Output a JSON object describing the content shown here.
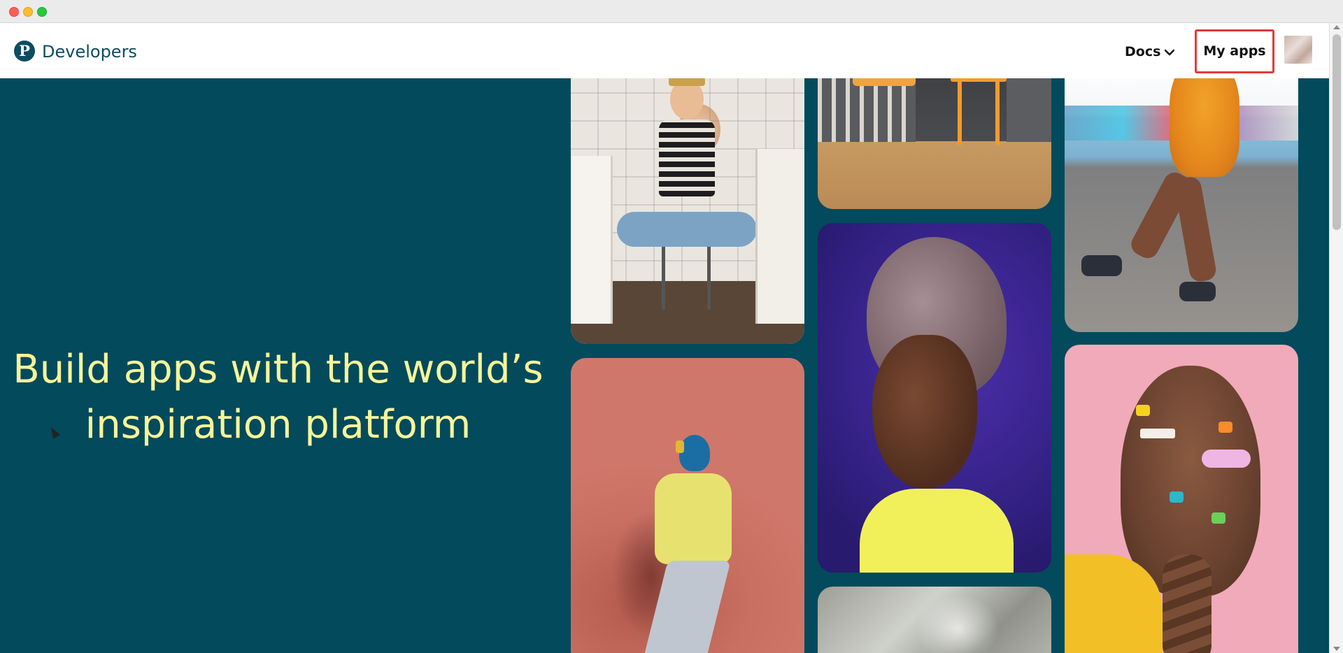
{
  "header": {
    "brand": "Developers",
    "docs_label": "Docs",
    "my_apps_label": "My apps"
  },
  "hero": {
    "line1": "Build apps with the world’s",
    "line2": "inspiration platform"
  },
  "colors": {
    "hero_bg": "#024a5c",
    "hero_text": "#f6f59a",
    "brand": "#0c4d62",
    "highlight": "#e03c3c"
  },
  "icons": [
    "pinterest-logo-icon",
    "chevron-down-icon",
    "mouse-cursor-icon"
  ],
  "images": [
    "woman-in-kitchen-photo",
    "crib-and-stool-photo",
    "dancing-woman-photo",
    "woman-running-with-headphones-photo",
    "woman-with-head-wrap-photo",
    "braided-hair-with-clips-photo",
    "hands-with-plastic-wrap-photo"
  ]
}
